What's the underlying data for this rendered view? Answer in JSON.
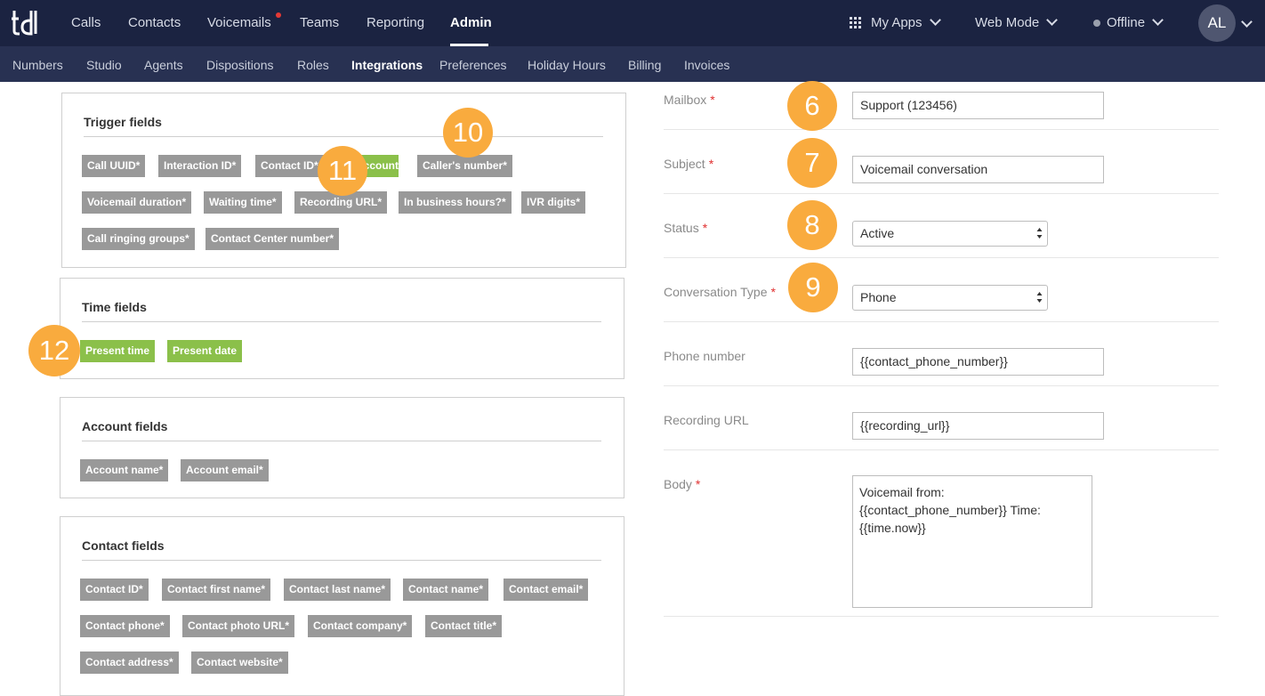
{
  "top_nav": {
    "items": [
      "Calls",
      "Contacts",
      "Voicemails",
      "Teams",
      "Reporting",
      "Admin"
    ],
    "active": "Admin",
    "my_apps": "My Apps",
    "web_mode": "Web Mode",
    "status": "Offline",
    "avatar_initials": "AL"
  },
  "sub_nav": {
    "items": [
      "Numbers",
      "Studio",
      "Agents",
      "Dispositions",
      "Roles",
      "Integrations",
      "Preferences",
      "Holiday Hours",
      "Billing",
      "Invoices"
    ],
    "active": "Integrations"
  },
  "trigger_fields": {
    "title": "Trigger fields",
    "tags": [
      "Call UUID*",
      "Interaction ID*",
      "Contact ID*",
      "Account ID",
      "Caller's number*",
      "Voicemail duration*",
      "Waiting time*",
      "Recording URL*",
      "In business hours?*",
      "IVR digits*",
      "Call ringing groups*",
      "Contact Center number*"
    ]
  },
  "time_fields": {
    "title": "Time fields",
    "tags": [
      "Present time",
      "Present date"
    ]
  },
  "account_fields": {
    "title": "Account fields",
    "tags": [
      "Account name*",
      "Account email*"
    ]
  },
  "contact_fields": {
    "title": "Contact fields",
    "tags": [
      "Contact ID*",
      "Contact first name*",
      "Contact last name*",
      "Contact name*",
      "Contact email*",
      "Contact phone*",
      "Contact photo URL*",
      "Contact company*",
      "Contact title*",
      "Contact address*",
      "Contact website*"
    ]
  },
  "form": {
    "mailbox": {
      "label": "Mailbox",
      "required_mark": "*",
      "value": "Support (123456)"
    },
    "subject": {
      "label": "Subject",
      "required_mark": "*",
      "value": "Voicemail conversation"
    },
    "status": {
      "label": "Status",
      "required_mark": "*",
      "value": "Active"
    },
    "conversation_type": {
      "label": "Conversation Type",
      "required_mark": "*",
      "value": "Phone"
    },
    "phone_number": {
      "label": "Phone number",
      "value": "{{contact_phone_number}}"
    },
    "recording_url": {
      "label": "Recording URL",
      "value": "{{recording_url}}"
    },
    "body": {
      "label": "Body",
      "required_mark": "*",
      "value": "Voicemail from: {{contact_phone_number}} Time: {{time.now}}"
    }
  },
  "markers": [
    "6",
    "7",
    "8",
    "9",
    "10",
    "11",
    "12"
  ],
  "colors": {
    "nav_bg": "#1b2341",
    "subnav_bg": "#283152",
    "tag_gray": "#999999",
    "tag_green": "#8bc04a",
    "marker_orange": "#f9ab3e",
    "required": "#e03030"
  }
}
